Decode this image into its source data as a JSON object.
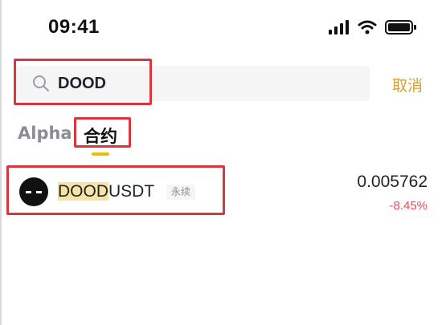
{
  "status_bar": {
    "time": "09:41",
    "icons": [
      "signal-icon",
      "wifi-icon",
      "battery-icon"
    ]
  },
  "search": {
    "value": "DOOD",
    "cancel_label": "取消"
  },
  "tabs": [
    {
      "label": "Alpha",
      "active": false
    },
    {
      "label": "合约",
      "active": true
    }
  ],
  "results": [
    {
      "symbol_match": "DOOD",
      "symbol_rest": "USDT",
      "badge": "永续",
      "price": "0.005762",
      "change": "-8.45%"
    }
  ],
  "colors": {
    "accent": "#d8a02b",
    "tab_indicator": "#f0b90b",
    "negative": "#f6465d",
    "highlight": "#f8e3a6",
    "annotation": "#d9363e"
  }
}
